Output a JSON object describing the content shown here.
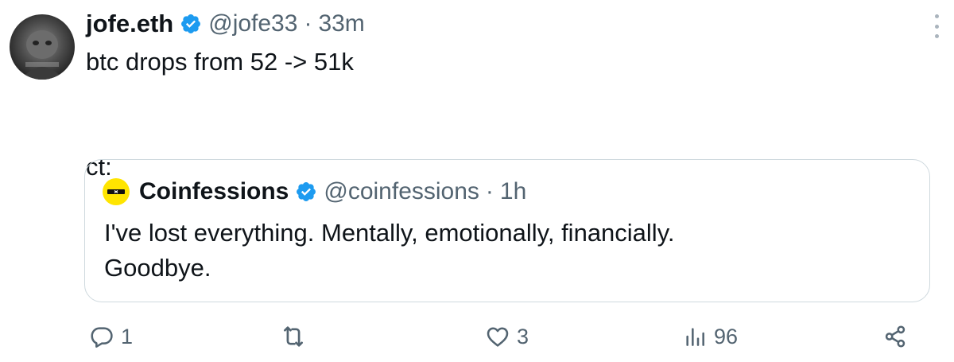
{
  "tweet": {
    "author": {
      "display_name": "jofe.eth",
      "handle": "@jofe33",
      "verified": true,
      "avatar_icon": "avatar-image"
    },
    "separator": "·",
    "time": "33m",
    "text": "btc drops from 52 -> 51k\n\n\nct:",
    "more_icon": "more-vertical-icon",
    "quoted": {
      "display_name": "Coinfessions",
      "handle": "@coinfessions",
      "verified": true,
      "time": "1h",
      "text": "I've lost everything. Mentally, emotionally, financially.\nGoodbye.",
      "avatar_color": "#ffe500"
    },
    "actions": {
      "replies": {
        "icon": "reply-icon",
        "count": "1"
      },
      "reposts": {
        "icon": "repost-icon",
        "count": ""
      },
      "likes": {
        "icon": "heart-icon",
        "count": "3"
      },
      "views": {
        "icon": "views-icon",
        "count": "96"
      },
      "share": {
        "icon": "share-icon"
      }
    }
  },
  "colors": {
    "text_primary": "#0f1419",
    "text_secondary": "#536471",
    "verified_blue": "#1d9bf0",
    "border": "#cfd9de"
  }
}
